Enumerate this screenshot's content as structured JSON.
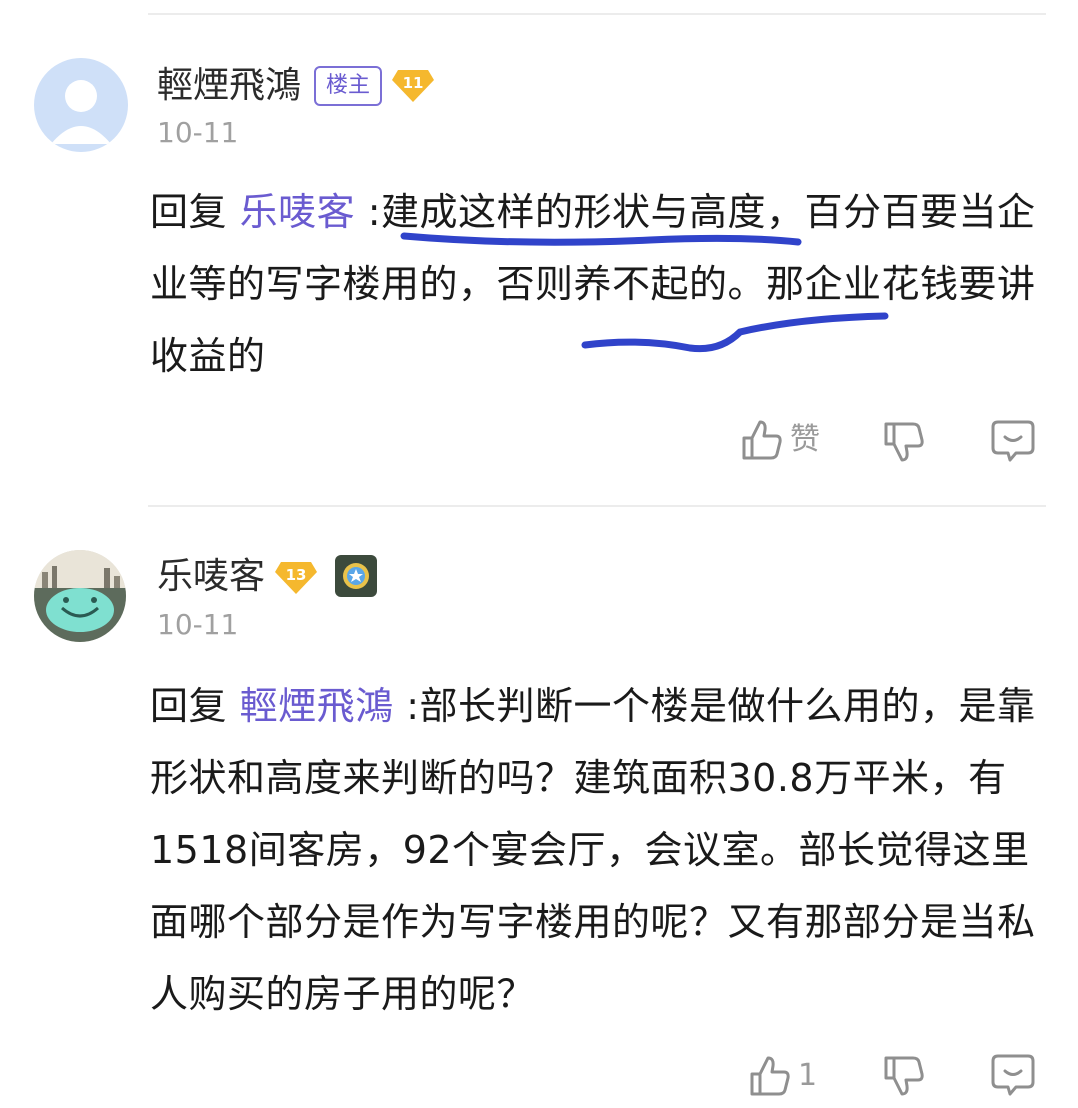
{
  "posts": [
    {
      "username": "輕煙飛鴻",
      "op_badge": "楼主",
      "level": "11",
      "time": "10-11",
      "reply_prefix": "回复",
      "reply_to": "乐唛客",
      "text": " :建成这样的形状与高度，百分百要当企业等的写字楼用的，否则养不起的。那企业花钱要讲收益的",
      "like_label": "赞",
      "avatar_icon": "default-avatar-icon",
      "annotation_color": "#1a2fc4"
    },
    {
      "username": "乐唛客",
      "level": "13",
      "time": "10-11",
      "reply_prefix": "回复",
      "reply_to": "輕煙飛鴻",
      "text": " :部长判断一个楼是做什么用的，是靠形状和高度来判断的吗？建筑面积30.8万平米，有1518间客房，92个宴会厅，会议室。部长觉得这里面哪个部分是作为写字楼用的呢？又有那部分是当私人购买的房子用的呢？",
      "like_count": "1",
      "avatar_icon": "masked-face-avatar-icon"
    }
  ],
  "colors": {
    "accent": "#6a5bd0",
    "level_badge": "#f5b82e",
    "muted": "#a0a0a0"
  }
}
